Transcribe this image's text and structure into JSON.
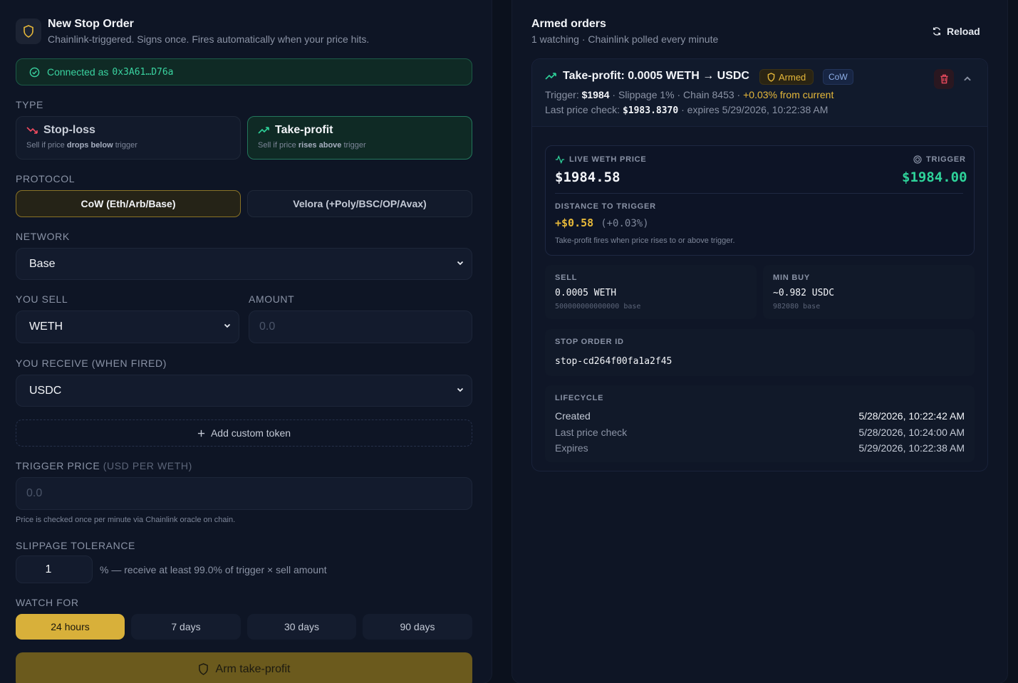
{
  "left": {
    "title": "New Stop Order",
    "subtitle": "Chainlink-triggered. Signs once. Fires automatically when your price hits.",
    "connected_prefix": "Connected as",
    "connected_address": "0x3A61…D76a",
    "type_label": "TYPE",
    "type_stop": {
      "title": "Stop-loss",
      "desc_pre": "Sell if price ",
      "desc_bold": "drops below",
      "desc_post": " trigger"
    },
    "type_take": {
      "title": "Take-profit",
      "desc_pre": "Sell if price ",
      "desc_bold": "rises above",
      "desc_post": " trigger"
    },
    "protocol_label": "PROTOCOL",
    "protocol_cow": "CoW (Eth/Arb/Base)",
    "protocol_velora": "Velora (+Poly/BSC/OP/Avax)",
    "network_label": "NETWORK",
    "network_value": "Base",
    "you_sell_label": "YOU SELL",
    "you_sell_value": "WETH",
    "amount_label": "AMOUNT",
    "amount_placeholder": "0.0",
    "receive_label": "YOU RECEIVE (WHEN FIRED)",
    "receive_value": "USDC",
    "add_token": "Add custom token",
    "trigger_label": "TRIGGER PRICE",
    "trigger_unit": "(USD PER WETH)",
    "trigger_placeholder": "0.0",
    "trigger_hint": "Price is checked once per minute via Chainlink oracle on chain.",
    "slippage_label": "SLIPPAGE TOLERANCE",
    "slippage_value": "1",
    "slippage_hint": "% — receive at least 99.0% of trigger × sell amount",
    "watch_label": "WATCH FOR",
    "watch_options": [
      "24 hours",
      "7 days",
      "30 days",
      "90 days"
    ],
    "arm_button": "Arm take-profit"
  },
  "right": {
    "title": "Armed orders",
    "subtitle": "1 watching · Chainlink polled every minute",
    "reload": "Reload",
    "order": {
      "title": "Take-profit: 0.0005 WETH → USDC",
      "badge_armed": "Armed",
      "badge_protocol": "CoW",
      "trigger_prefix": "Trigger: ",
      "trigger_value": "$1984",
      "trigger_rest": " · Slippage 1% · Chain 8453 · ",
      "trigger_pct": "+0.03% from current",
      "check_prefix": "Last price check: ",
      "check_value": "$1983.8370",
      "check_rest": " · expires 5/29/2026, 10:22:38 AM",
      "live_label": "LIVE WETH PRICE",
      "live_value": "$1984.58",
      "trigger_label": "TRIGGER",
      "trigger_big": "$1984.00",
      "distance_label": "DISTANCE TO TRIGGER",
      "distance_value": "+$0.58",
      "distance_pct": "(+0.03%)",
      "distance_hint": "Take-profit fires when price rises to or above trigger.",
      "sell_label": "SELL",
      "sell_value": "0.0005 WETH",
      "sell_base": "500000000000000 base",
      "minbuy_label": "MIN BUY",
      "minbuy_value": "~0.982 USDC",
      "minbuy_base": "982080 base",
      "id_label": "STOP ORDER ID",
      "id_value": "stop-cd264f00fa1a2f45",
      "lifecycle_label": "LIFECYCLE",
      "lifecycle": [
        {
          "label": "Created",
          "value": "5/28/2026, 10:22:42 AM"
        },
        {
          "label": "Last price check",
          "value": "5/28/2026, 10:24:00 AM"
        },
        {
          "label": "Expires",
          "value": "5/29/2026, 10:22:38 AM"
        }
      ]
    }
  },
  "colors": {
    "accent_gold": "#d8b03a",
    "green": "#2ed39a",
    "red": "#ef4b5f",
    "background": "#0b111d"
  }
}
